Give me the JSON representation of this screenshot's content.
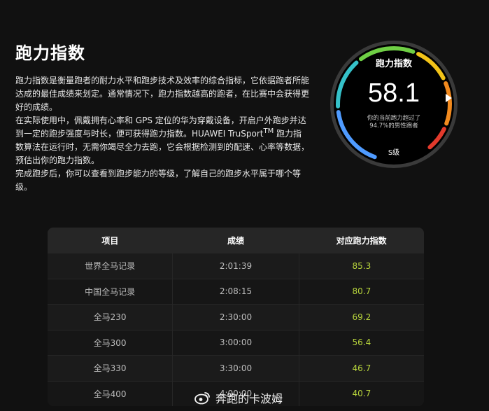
{
  "title": "跑力指数",
  "description": {
    "p1": "跑力指数是衡量跑者的耐力水平和跑步技术及效率的综合指标，它依据跑者所能达成的最佳成绩来划定。通常情况下，跑力指数越高的跑者，在比赛中会获得更好的成绩。",
    "p2_before": "在实际使用中，佩戴拥有心率和 GPS 定位的华为穿戴设备，开启户外跑步并达到一定的跑步强度与时长，便可获得跑力指数。HUAWEI TruSport",
    "p2_tm": "TM",
    "p2_after": " 跑力指数算法在运行时，无需你竭尽全力去跑，它会根据检测到的配速、心率等数据，预估出你的跑力指数。",
    "p3": "完成跑步后，你可以查看到跑步能力的等级，了解自己的跑步水平属于哪个等级。"
  },
  "watch": {
    "title": "跑力指数",
    "value": "58.1",
    "sub_line1": "你的当前跑力超过了",
    "sub_line2": "94.7%的男性跑者",
    "level": "S级",
    "colors": {
      "blue": "#4f9bff",
      "cyan": "#35c1c9",
      "green": "#6fcf45",
      "yellow": "#f2c318",
      "orange": "#f28a1e",
      "red": "#e23a2c"
    }
  },
  "table": {
    "headers": [
      "项目",
      "成绩",
      "对应跑力指数"
    ],
    "rows": [
      {
        "item": "世界全马记录",
        "result": "2:01:39",
        "index": "85.3"
      },
      {
        "item": "中国全马记录",
        "result": "2:08:15",
        "index": "80.7"
      },
      {
        "item": "全马230",
        "result": "2:30:00",
        "index": "69.2"
      },
      {
        "item": "全马300",
        "result": "3:00:00",
        "index": "56.4"
      },
      {
        "item": "全马330",
        "result": "3:30:00",
        "index": "46.7"
      },
      {
        "item": "全马400",
        "result": "4:00:00",
        "index": "40.7"
      }
    ]
  },
  "watermark": "奔跑的卡波姆"
}
